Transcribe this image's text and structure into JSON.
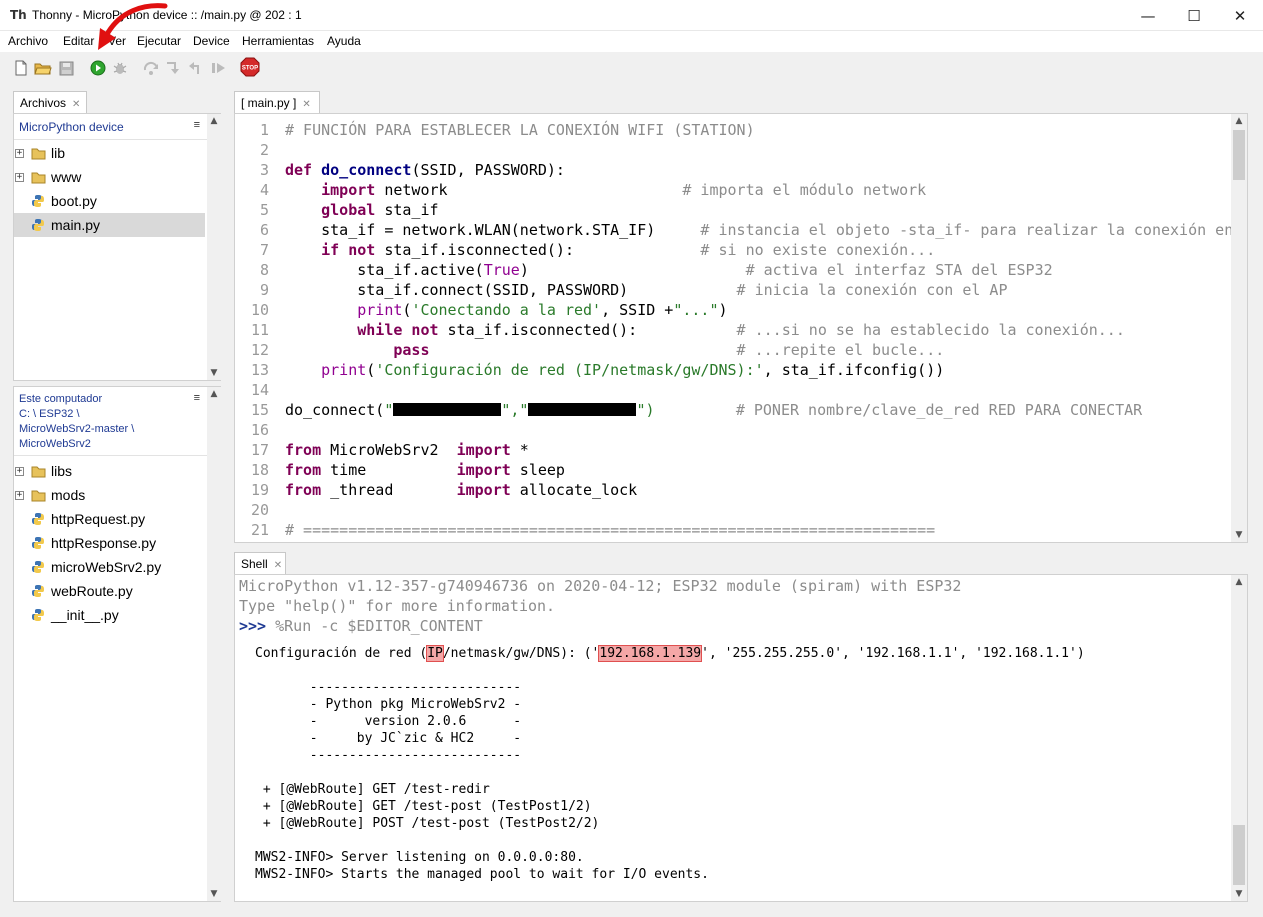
{
  "window": {
    "app_name": "Thonny",
    "title": "Thonny  -  MicroPython device :: /main.py  @  202 : 1"
  },
  "menu": [
    "Archivo",
    "Editar",
    "Ver",
    "Ejecutar",
    "Device",
    "Herramientas",
    "Ayuda"
  ],
  "toolbar": {
    "buttons": [
      "new-file-icon",
      "open-file-icon",
      "save-file-icon",
      "run-icon",
      "debug-icon",
      "step-over-icon",
      "step-into-icon",
      "step-out-icon",
      "resume-icon",
      "stop-icon"
    ],
    "stop_label": "STOP"
  },
  "files_panel": {
    "tab_label": "Archivos",
    "device": {
      "header": "MicroPython device",
      "items": [
        {
          "label": "lib",
          "type": "folder"
        },
        {
          "label": "www",
          "type": "folder"
        },
        {
          "label": "boot.py",
          "type": "file"
        },
        {
          "label": "main.py",
          "type": "file",
          "selected": true
        }
      ]
    },
    "local": {
      "header": "Este computador",
      "path_lines": [
        "C: \\ ESP32 \\",
        "MicroWebSrv2-master \\",
        "MicroWebSrv2"
      ],
      "items": [
        {
          "label": "libs",
          "type": "folder"
        },
        {
          "label": "mods",
          "type": "folder"
        },
        {
          "label": "httpRequest.py",
          "type": "file"
        },
        {
          "label": "httpResponse.py",
          "type": "file"
        },
        {
          "label": "microWebSrv2.py",
          "type": "file"
        },
        {
          "label": "webRoute.py",
          "type": "file"
        },
        {
          "label": "__init__.py",
          "type": "file"
        }
      ]
    },
    "menu_glyph": "≡"
  },
  "editor": {
    "tab_label": "[ main.py ]",
    "line_numbers": [
      "1",
      "2",
      "3",
      "4",
      "5",
      "6",
      "7",
      "8",
      "9",
      "10",
      "11",
      "12",
      "13",
      "14",
      "15",
      "16",
      "17",
      "18",
      "19",
      "20",
      "21"
    ],
    "lines": {
      "l1": "# FUNCIÓN PARA ESTABLECER LA CONEXIÓN WIFI (STATION)",
      "l3a": "def ",
      "l3b": "do_connect",
      "l3c": "(SSID, PASSWORD):",
      "l4a": "    import",
      "l4b": " network                          ",
      "l4c": "# importa el módulo network",
      "l5a": "    global",
      "l5b": " sta_if",
      "l6a": "    sta_if = network.WLAN(network.STA_IF)     ",
      "l6b": "# instancia el objeto -sta_if- para realizar la conexión en",
      "l7a": "    if not",
      "l7b": " sta_if.isconnected():              ",
      "l7c": "# si no existe conexión...",
      "l8a": "        sta_if.active(",
      "l8b": "True",
      "l8c": ")                        ",
      "l8d": "# activa el interfaz STA del ESP32",
      "l9a": "        sta_if.connect(SSID, PASSWORD)            ",
      "l9b": "# inicia la conexión con el AP",
      "l10a": "        ",
      "l10b": "print",
      "l10c": "(",
      "l10d": "'Conectando a la red'",
      "l10e": ", SSID +",
      "l10f": "\"...\"",
      "l10g": ")",
      "l11a": "        while not",
      "l11b": " sta_if.isconnected():           ",
      "l11c": "# ...si no se ha establecido la conexión...",
      "l12a": "            pass",
      "l12b": "                                  ",
      "l12c": "# ...repite el bucle...",
      "l13a": "    ",
      "l13b": "print",
      "l13c": "(",
      "l13d": "'Configuración de red (IP/netmask/gw/DNS):'",
      "l13e": ", sta_if.ifconfig())",
      "l15a": "do_connect(",
      "l15b": "\"",
      "l15c": "\",\"",
      "l15d": "\")",
      "l15e": "         ",
      "l15f": "# PONER nombre/clave_de_red RED PARA CONECTAR",
      "l17a": "from",
      "l17b": " MicroWebSrv2  ",
      "l17c": "import",
      "l17d": " *",
      "l18a": "from",
      "l18b": " time          ",
      "l18c": "import",
      "l18d": " sleep",
      "l19a": "from",
      "l19b": " _thread       ",
      "l19c": "import",
      "l19d": " allocate_lock",
      "l21": "# ======================================================================"
    }
  },
  "shell": {
    "tab_label": "Shell",
    "banner1": "MicroPython v1.12-357-g740946736 on 2020-04-12; ESP32 module (spiram) with ESP32",
    "banner2": "Type \"help()\" for more information.",
    "prompt": ">>>",
    "command": " %Run -c $EDITOR_CONTENT",
    "config_a": "Configuración de red (",
    "config_ip_word": "IP",
    "config_b": "/netmask/gw/DNS): ('",
    "config_ip": "192.168.1.139",
    "config_c": "', '255.255.255.0', '192.168.1.1', '192.168.1.1')",
    "banner_box": [
      "       ---------------------------",
      "       - Python pkg MicroWebSrv2 -",
      "       -      version 2.0.6      -",
      "       -     by JC`zic & HC2     -",
      "       ---------------------------"
    ],
    "routes": [
      " + [@WebRoute] GET /test-redir",
      " + [@WebRoute] GET /test-post (TestPost1/2)",
      " + [@WebRoute] POST /test-post (TestPost2/2)"
    ],
    "info": [
      "MWS2-INFO> Server listening on 0.0.0.0:80.",
      "MWS2-INFO> Starts the managed pool to wait for I/O events."
    ]
  },
  "colors": {
    "keyword": "#7f0055",
    "comment": "#8c8c8c",
    "string": "#2a7a2a",
    "builtin": "#900090",
    "highlight": "#f4a7a7",
    "arrow": "#e01010"
  }
}
